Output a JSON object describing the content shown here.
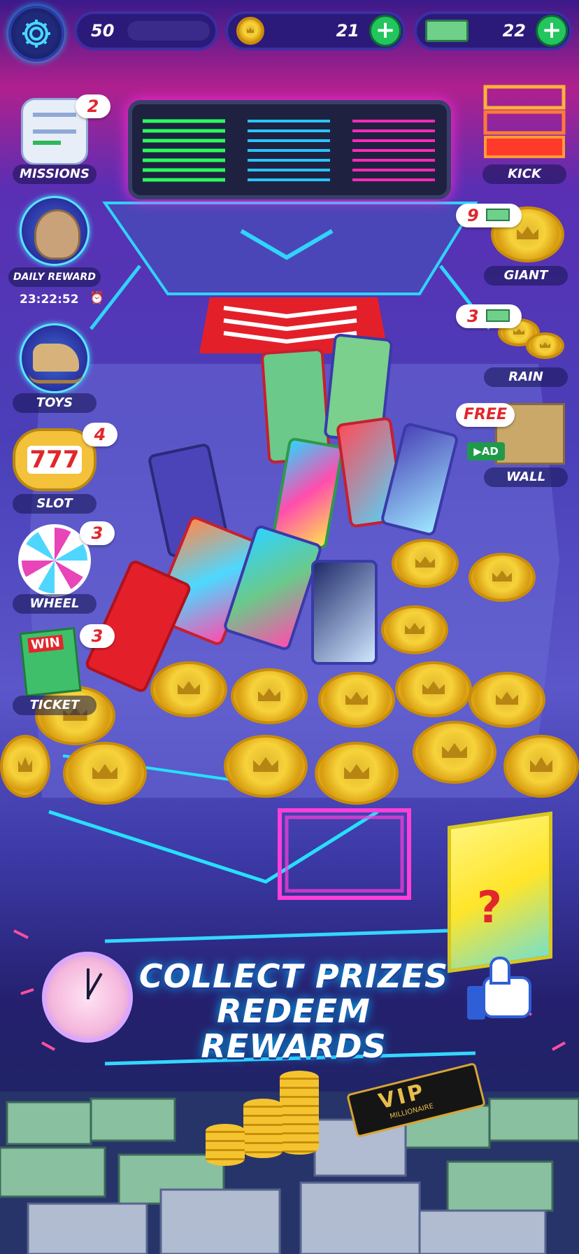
{
  "topbar": {
    "level": "50",
    "coins": "21",
    "cash": "22",
    "settings_icon": "gear-icon"
  },
  "left_menu": [
    {
      "label": "MISSIONS",
      "badge": "2",
      "icon": "checklist-icon"
    },
    {
      "label": "DAILY REWARD",
      "timer": "23:22:52",
      "icon": "money-bag-icon"
    },
    {
      "label": "TOYS",
      "icon": "rocking-horse-icon"
    },
    {
      "label": "SLOT",
      "badge": "4",
      "icon": "slot-machine-icon",
      "slot_text": "777"
    },
    {
      "label": "WHEEL",
      "badge": "3",
      "icon": "prize-wheel-icon"
    },
    {
      "label": "TICKET",
      "badge": "3",
      "icon": "ticket-icon",
      "ticket_text": "WIN"
    }
  ],
  "right_menu": [
    {
      "label": "KICK",
      "icon": "neon-pusher-icon"
    },
    {
      "label": "GIANT",
      "badge": "9",
      "icon": "giant-coin-icon"
    },
    {
      "label": "RAIN",
      "badge": "3",
      "icon": "coin-rain-icon"
    },
    {
      "label": "WALL",
      "badge": "FREE",
      "ad_label": "AD",
      "icon": "wall-icon"
    }
  ],
  "banner": {
    "line1": "COLLECT PRIZES",
    "line2": "REDEEM REWARDS"
  },
  "mystery_box": {
    "symbol": "?"
  },
  "vip_card": {
    "text": "VIP",
    "subtext": "MILLIONAIRE"
  },
  "colors": {
    "accent_cyan": "#00d5ff",
    "neon_pink": "#ff2bd6",
    "coin_gold": "#f7d33b",
    "badge_red": "#e2262c",
    "plus_green": "#22c55e"
  }
}
